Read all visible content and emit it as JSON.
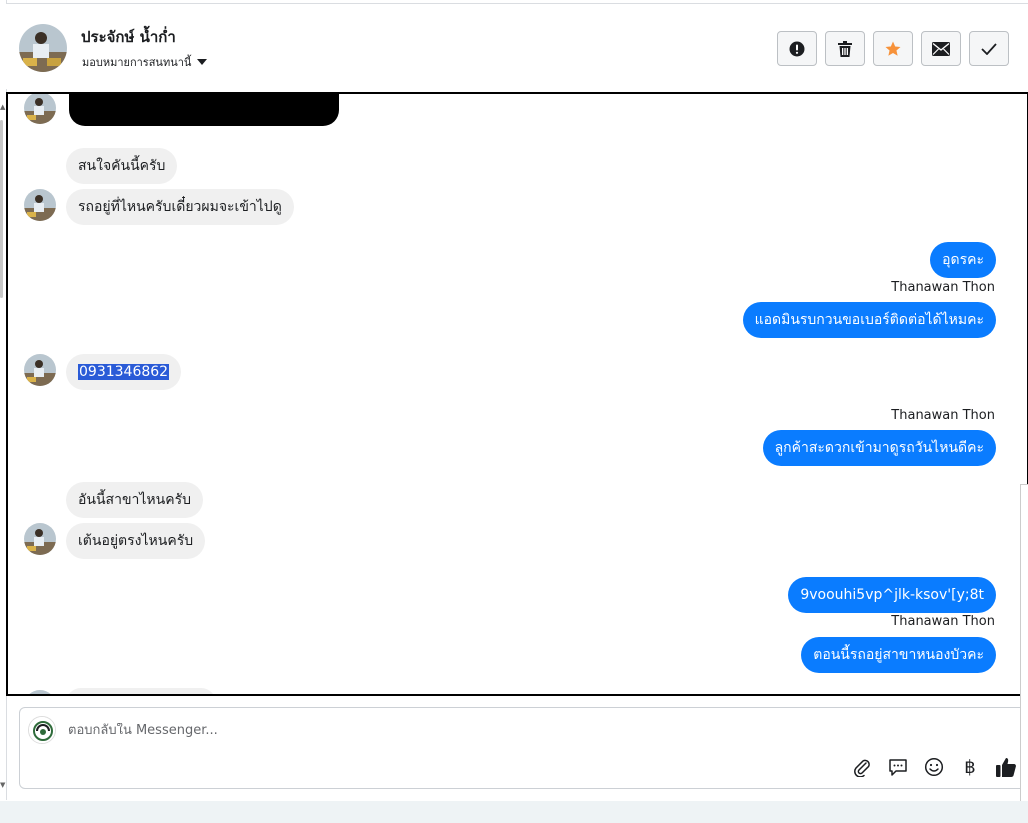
{
  "header": {
    "contact_name": "ประจักษ์ น้ำก่ำ",
    "assign_label": "มอบหมายการสนทนานี้"
  },
  "actions": {
    "icons": [
      "exclamation-circle-icon",
      "trash-icon",
      "star-icon",
      "envelope-icon",
      "check-icon"
    ],
    "star_color": "#f7923a"
  },
  "messages": {
    "m1": "สนใจคันนี้ครับ",
    "m2": "รถอยู่ที่ไหนครับเดี๋ยวผมจะเข้าไปดู",
    "m3": "อุดรคะ",
    "sender1": "Thanawan Thon",
    "m4": "แอดมินรบกวนขอเบอร์ติดต่อได้ไหมคะ",
    "m5": "0931346862",
    "sender2": "Thanawan Thon",
    "m6": "ลูกค้าสะดวกเข้ามาดูรถวันไหนดีคะ",
    "m7": "อันนี้สาขาไหนครับ",
    "m8": "เต้นอยู่ตรงไหนครับ",
    "m9": "9voouhi5vp^jlk-ksov'[y;8t",
    "sender3": "Thanawan Thon",
    "m10": "ตอนนี้รถอยู่สาขาหนองบัวคะ"
  },
  "composer": {
    "placeholder": "ตอบกลับใน Messenger...",
    "tools": [
      "paperclip-icon",
      "speech-bubble-icon",
      "smiley-icon",
      "baht-icon",
      "thumbs-up-icon"
    ],
    "baht_symbol": "฿"
  },
  "colors": {
    "outgoing_bubble": "#0a7cff",
    "incoming_bubble": "#f0f0f0"
  }
}
